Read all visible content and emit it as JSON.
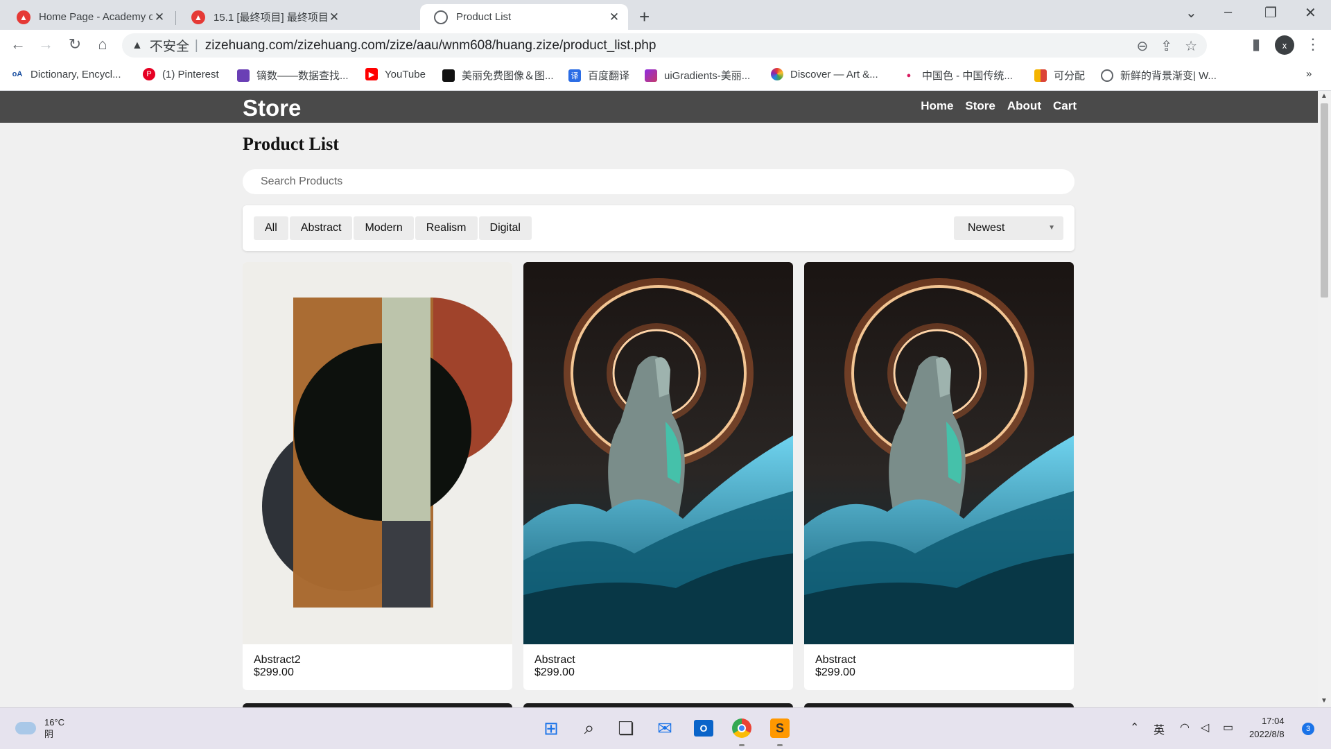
{
  "browser": {
    "tabs": [
      {
        "title": "Home Page - Academy of Art",
        "active": false
      },
      {
        "title": "15.1 [最终项目] 最终项目 - IXD",
        "active": false
      },
      {
        "title": "Product List",
        "active": true
      }
    ],
    "address": {
      "security_label": "不安全",
      "url": "zizehuang.com/zizehuang.com/zize/aau/wnm608/huang.zize/product_list.php"
    },
    "profile_initial": "x",
    "bookmarks": [
      {
        "label": "Dictionary, Encycl..."
      },
      {
        "label": "(1) Pinterest"
      },
      {
        "label": "镝数——数据查找..."
      },
      {
        "label": "YouTube"
      },
      {
        "label": "美丽免费图像＆图..."
      },
      {
        "label": "百度翻译"
      },
      {
        "label": "uiGradients-美丽..."
      },
      {
        "label": "Discover — Art &..."
      },
      {
        "label": "中国色 - 中国传统..."
      },
      {
        "label": "可分配"
      },
      {
        "label": "新鲜的背景渐变| W..."
      }
    ],
    "bookmarks_more": "»"
  },
  "site": {
    "brand": "Store",
    "nav": [
      "Home",
      "Store",
      "About",
      "Cart"
    ],
    "page_title": "Product List",
    "search_placeholder": "Search Products",
    "filters": [
      "All",
      "Abstract",
      "Modern",
      "Realism",
      "Digital"
    ],
    "sort_selected": "Newest",
    "products": [
      {
        "name": "Abstract2",
        "price": "$299.00",
        "image": "geometric-abstract-art"
      },
      {
        "name": "Abstract",
        "price": "$299.00",
        "image": "statue-neon-rings"
      },
      {
        "name": "Abstract",
        "price": "$299.00",
        "image": "statue-neon-rings"
      }
    ]
  },
  "taskbar": {
    "weather_temp": "16°C",
    "weather_desc": "阴",
    "ime": "英",
    "time": "17:04",
    "date": "2022/8/8",
    "notifications": "3"
  }
}
